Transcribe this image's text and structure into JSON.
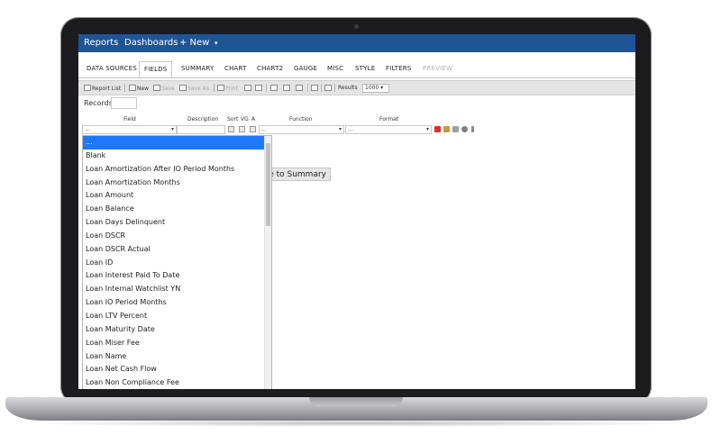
{
  "nav": {
    "reports": "Reports",
    "dashboards": "Dashboards",
    "new_label": "+ New",
    "new_caret": "▾"
  },
  "tabs": [
    {
      "label": "DATA SOURCES"
    },
    {
      "label": "FIELDS"
    },
    {
      "label": "SUMMARY"
    },
    {
      "label": "CHART"
    },
    {
      "label": "CHART2"
    },
    {
      "label": "GAUGE"
    },
    {
      "label": "MISC"
    },
    {
      "label": "STYLE"
    },
    {
      "label": "FILTERS"
    },
    {
      "label": "PREVIEW"
    }
  ],
  "toolbar": {
    "report_list": "Report List",
    "new": "New",
    "save": "Save",
    "save_as": "Save As...",
    "print": "Print",
    "results_label": "Results",
    "results_value": "1000 ▾"
  },
  "records": {
    "label": "Records",
    "value": ""
  },
  "columns": {
    "field": "Field",
    "description": "Description",
    "sort": "Sort",
    "vg": "VG",
    "a": "A",
    "function": "Function",
    "format": "Format"
  },
  "row": {
    "field_value": "...",
    "function_value": "...",
    "format_value": "...",
    "arrow": "▾"
  },
  "summary_button": "e to Summary",
  "dropdown": {
    "items": [
      "...",
      "Blank",
      "Loan Amortization After IO Period Months",
      "Loan Amortization Months",
      "Loan Amount",
      "Loan Balance",
      "Loan Days Delinquent",
      "Loan DSCR",
      "Loan DSCR Actual",
      "Loan ID",
      "Loan Interest Paid To Date",
      "Loan Internal Watchlist YN",
      "Loan IO Period Months",
      "Loan LTV Percent",
      "Loan Maturity Date",
      "Loan Miser Fee",
      "Loan Name",
      "Loan Net Cash Flow",
      "Loan Non Compliance Fee"
    ],
    "selected_index": 0
  },
  "colors": {
    "nav_bar": "#1f5596",
    "selected": "#1e78ff",
    "bezel": "#1c1c1e"
  }
}
